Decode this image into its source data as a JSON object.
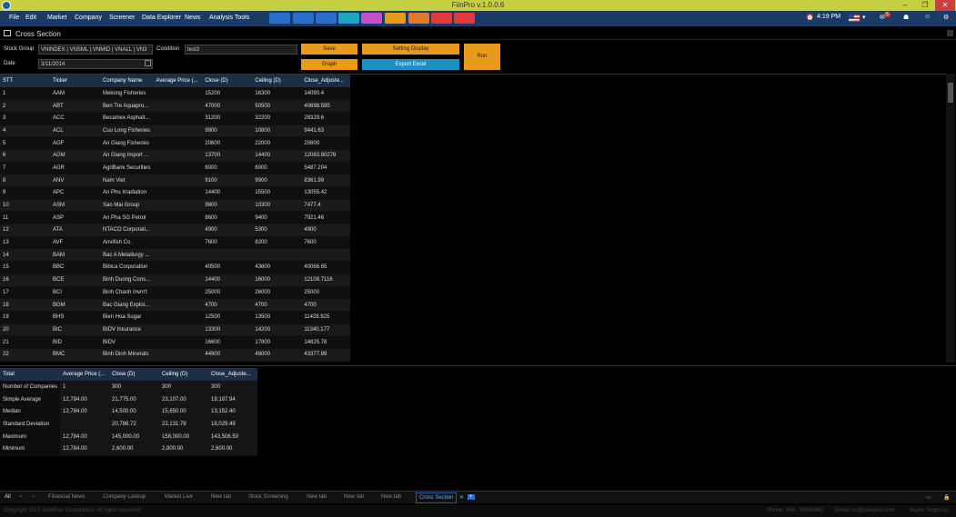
{
  "window": {
    "title": "FiinPro v.1.0.0.6"
  },
  "menu": [
    "File",
    "Edit",
    "Market",
    "Company",
    "Screener",
    "Data Explorer",
    "News",
    "Analysis Tools"
  ],
  "toolbar_colors": [
    "#2a6fc9",
    "#2a6fc9",
    "#2a6fc9",
    "#1fa3c9",
    "#c94fc9",
    "#e89a1a",
    "#e07a2a",
    "#e03a3a",
    "#e03a3a"
  ],
  "status": {
    "time": "4:19 PM",
    "notification_count": "5"
  },
  "panel": {
    "title": "Cross Section"
  },
  "form": {
    "stock_group_label": "Stock Group",
    "stock_group_value": "VNINDEX | VNSML | VNMID | VNALL | VN3",
    "condition_label": "Condition",
    "condition_value": "test3",
    "date_label": "Date",
    "date_value": "3/11/2014",
    "save": "Save",
    "setting_display": "Setting Display",
    "graph": "Graph",
    "export_excel": "Export Excel",
    "run": "Run"
  },
  "table": {
    "headers": [
      "STT",
      "Ticker",
      "Company Name",
      "Average Price (...",
      "Close (D)",
      "Ceiling (D)",
      "Close_Adjuste..."
    ],
    "rows": [
      [
        "1",
        "AAM",
        "Mekong Fisheries",
        "",
        "15200",
        "16300",
        "14090.4"
      ],
      [
        "2",
        "ABT",
        "Ben Tre Aquapro...",
        "",
        "47000",
        "50500",
        "40698.595"
      ],
      [
        "3",
        "ACC",
        "Becamex Asphalt...",
        "",
        "31200",
        "32200",
        "28329.6"
      ],
      [
        "4",
        "ACL",
        "Cuu Long Fisheries",
        "",
        "9900",
        "10800",
        "9441.63"
      ],
      [
        "5",
        "AGF",
        "An Giang Fisheries",
        "",
        "20600",
        "22000",
        "20600"
      ],
      [
        "6",
        "AGM",
        "An Giang Import ...",
        "",
        "13700",
        "14400",
        "12083.80278"
      ],
      [
        "7",
        "AGR",
        "AgriBank Securities",
        "",
        "6000",
        "6000",
        "5487.204"
      ],
      [
        "8",
        "ANV",
        "Nam Viet",
        "",
        "9100",
        "9900",
        "8361.99"
      ],
      [
        "9",
        "APC",
        "An Phu Irradiation",
        "",
        "14400",
        "15500",
        "13055.42"
      ],
      [
        "10",
        "ASM",
        "Sao Mai Group",
        "",
        "9800",
        "10300",
        "7477.4"
      ],
      [
        "11",
        "ASP",
        "An Pha SG Petrol",
        "",
        "8600",
        "9400",
        "7921.46"
      ],
      [
        "12",
        "ATA",
        "NTACO Corporati...",
        "",
        "4900",
        "5300",
        "4900"
      ],
      [
        "13",
        "AVF",
        "Anvifish Co.",
        "",
        "7600",
        "8200",
        "7600"
      ],
      [
        "14",
        "BAM",
        "Bac A Metallurgy ...",
        "",
        "",
        "",
        ""
      ],
      [
        "15",
        "BBC",
        "Bibica Corporation",
        "",
        "40500",
        "43600",
        "40066.65"
      ],
      [
        "16",
        "BCE",
        "Binh Duong Cons...",
        "",
        "14400",
        "16000",
        "12108.7116"
      ],
      [
        "17",
        "BCI",
        "Binh Chanh Invm't",
        "",
        "25000",
        "26000",
        "25000"
      ],
      [
        "18",
        "BGM",
        "Bac Giang Exploi...",
        "",
        "4700",
        "4700",
        "4700"
      ],
      [
        "19",
        "BHS",
        "Bien Hoa Sugar",
        "",
        "12500",
        "13500",
        "11428.925"
      ],
      [
        "20",
        "BIC",
        "BIDV Insurance",
        "",
        "13300",
        "14200",
        "11340.177"
      ],
      [
        "21",
        "BID",
        "BIDV",
        "",
        "16600",
        "17800",
        "14825.78"
      ],
      [
        "22",
        "BMC",
        "Binh Dinh Minerals",
        "",
        "44900",
        "48000",
        "43377.89"
      ]
    ]
  },
  "summary": {
    "headers": [
      "Total",
      "",
      "",
      "Average Price (...",
      "Close (D)",
      "Ceiling (D)",
      "Close_Adjuste..."
    ],
    "rows": [
      [
        "Number of Companies",
        "1",
        "300",
        "300",
        "300"
      ],
      [
        "Simple Average",
        "12,784.00",
        "21,775.00",
        "23,107.00",
        "19,187.94"
      ],
      [
        "Median",
        "12,784.00",
        "14,500.00",
        "15,650.00",
        "13,152.40"
      ],
      [
        "Standard Deviation",
        "",
        "20,786.72",
        "22,131.78",
        "18,029.49"
      ],
      [
        "Maximum",
        "12,784.00",
        "145,000.00",
        "158,000.00",
        "143,506.50"
      ],
      [
        "Minimum",
        "12,784.00",
        "2,600.00",
        "2,800.00",
        "2,600.00"
      ]
    ]
  },
  "tabs": [
    "All",
    "Financial News",
    "Company Lookup",
    "Market Live",
    "New tab",
    "Stock Screening",
    "New tab",
    "New tab",
    "New tab",
    "Cross Section"
  ],
  "footer": {
    "copyright": "Copyright 2015 StoxPlus Corporation, All rights reserved",
    "phone": "Phone: 044 - 35626962",
    "email": "Email: cs@stoxplus.com",
    "skype": "Skype: fiinpro.cs"
  }
}
